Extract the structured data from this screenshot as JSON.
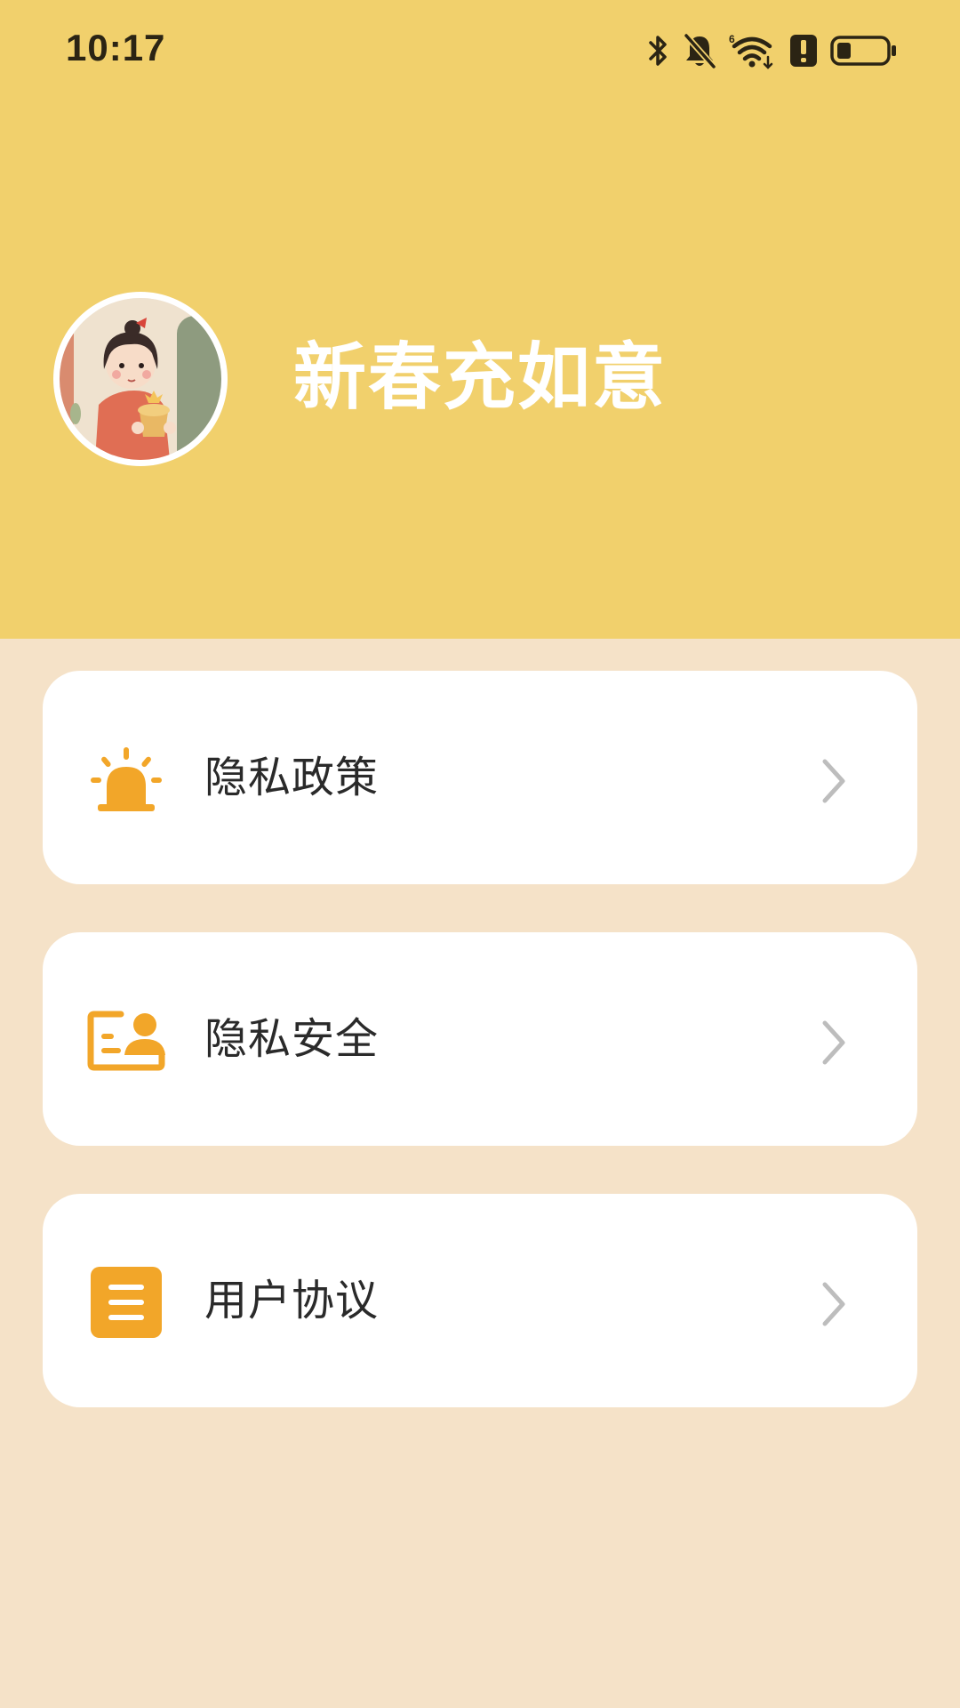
{
  "status_bar": {
    "time": "10:17",
    "icons": [
      "bluetooth-icon",
      "mute-bell-icon",
      "wifi-6-icon",
      "alert-icon",
      "battery-icon"
    ]
  },
  "profile": {
    "name": "新春充如意",
    "avatar": "girl-illustration-avatar"
  },
  "menu": {
    "items": [
      {
        "label": "隐私政策",
        "icon": "alarm-siren-icon"
      },
      {
        "label": "隐私安全",
        "icon": "user-card-icon"
      },
      {
        "label": "用户协议",
        "icon": "document-list-icon"
      }
    ]
  },
  "colors": {
    "header_bg": "#F1D06C",
    "page_bg": "#F5E2C8",
    "accent_icon": "#F2A629",
    "card_bg": "#FFFFFF",
    "chevron": "#BDBDBD"
  }
}
